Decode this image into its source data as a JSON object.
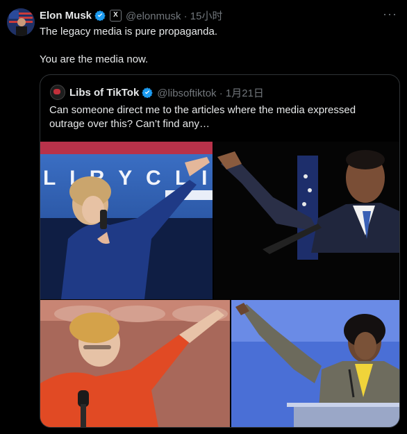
{
  "tweet": {
    "author_name": "Elon Musk",
    "handle_time": "@elonmusk · 15小时",
    "badge_glyph": "X",
    "more_glyph": "···",
    "line1": "The legacy media is pure propaganda.",
    "line2": "You are the media now."
  },
  "quoted": {
    "author_name": "Libs of TikTok",
    "handle_time": "@libsoftiktok · 1月21日",
    "text": "Can someone direct me to the articles where the media expressed outrage over this? Can’t find any…",
    "photos": {
      "backdrop_letters": "L I  R Y C L I"
    }
  },
  "colors": {
    "background": "#000000",
    "text": "#e7e9ea",
    "muted": "#71767b",
    "verified": "#1d9bf0",
    "border": "#2f3336"
  }
}
